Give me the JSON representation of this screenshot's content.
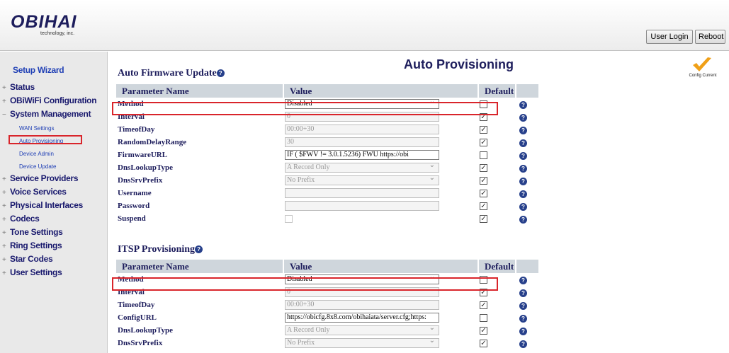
{
  "header": {
    "logo_main": "OBIHAI",
    "logo_sub": "technology, inc.",
    "user_login": "User Login",
    "reboot": "Reboot"
  },
  "sidebar": {
    "setup_wizard": "Setup Wizard",
    "items": [
      {
        "sign": "+",
        "label": "Status"
      },
      {
        "sign": "+",
        "label": "OBiWiFi Configuration"
      },
      {
        "sign": "−",
        "label": "System Management"
      },
      {
        "sign": "+",
        "label": "Service Providers"
      },
      {
        "sign": "+",
        "label": "Voice Services"
      },
      {
        "sign": "+",
        "label": "Physical Interfaces"
      },
      {
        "sign": "+",
        "label": "Codecs"
      },
      {
        "sign": "+",
        "label": "Tone Settings"
      },
      {
        "sign": "+",
        "label": "Ring Settings"
      },
      {
        "sign": "+",
        "label": "Star Codes"
      },
      {
        "sign": "+",
        "label": "User Settings"
      }
    ],
    "sub_items": [
      "WAN Settings",
      "Auto Provisioning",
      "Device Admin",
      "Device Update"
    ],
    "selected": "Auto Provisioning"
  },
  "main": {
    "page_title": "Auto Provisioning",
    "config_status": "Config Current",
    "columns": [
      "Parameter Name",
      "Value",
      "Default"
    ],
    "help_glyph": "?",
    "sections": [
      {
        "title": "Auto Firmware Update",
        "rows": [
          {
            "name": "Method",
            "value": "Disabled",
            "select": true,
            "enabled": true,
            "default_checked": false
          },
          {
            "name": "Interval",
            "value": "0",
            "select": false,
            "enabled": false,
            "default_checked": true
          },
          {
            "name": "TimeofDay",
            "value": "00:00+30",
            "select": false,
            "enabled": false,
            "default_checked": true
          },
          {
            "name": "RandomDelayRange",
            "value": "30",
            "select": false,
            "enabled": false,
            "default_checked": true
          },
          {
            "name": "FirmwareURL",
            "value": "IF ( $FWV != 3.0.1.5236) FWU        https://obi",
            "select": false,
            "enabled": true,
            "default_checked": false
          },
          {
            "name": "DnsLookupType",
            "value": "A Record Only",
            "select": true,
            "enabled": false,
            "default_checked": true
          },
          {
            "name": "DnsSrvPrefix",
            "value": "No Prefix",
            "select": true,
            "enabled": false,
            "default_checked": true
          },
          {
            "name": "Username",
            "value": "",
            "select": false,
            "enabled": false,
            "default_checked": true
          },
          {
            "name": "Password",
            "value": "",
            "select": false,
            "enabled": false,
            "default_checked": true
          },
          {
            "name": "Suspend",
            "value": "",
            "select": false,
            "enabled": false,
            "default_checked": true,
            "checkbox_value": true
          }
        ]
      },
      {
        "title": "ITSP Provisioning",
        "rows": [
          {
            "name": "Method",
            "value": "Disabled",
            "select": true,
            "enabled": true,
            "default_checked": false
          },
          {
            "name": "Interval",
            "value": "0",
            "select": false,
            "enabled": false,
            "default_checked": true
          },
          {
            "name": "TimeofDay",
            "value": "00:00+30",
            "select": false,
            "enabled": false,
            "default_checked": true
          },
          {
            "name": "ConfigURL",
            "value": "https://obicfg.8x8.com/obihaiata/server.cfg;https:",
            "select": false,
            "enabled": true,
            "default_checked": false
          },
          {
            "name": "DnsLookupType",
            "value": "A Record Only",
            "select": true,
            "enabled": false,
            "default_checked": true
          },
          {
            "name": "DnsSrvPrefix",
            "value": "No Prefix",
            "select": true,
            "enabled": false,
            "default_checked": true
          }
        ]
      }
    ]
  },
  "colors": {
    "highlight": "#d9252b",
    "header_bg": "#cfd6dc",
    "text_navy": "#1d1d5c",
    "checkmark": "#f0a018"
  }
}
